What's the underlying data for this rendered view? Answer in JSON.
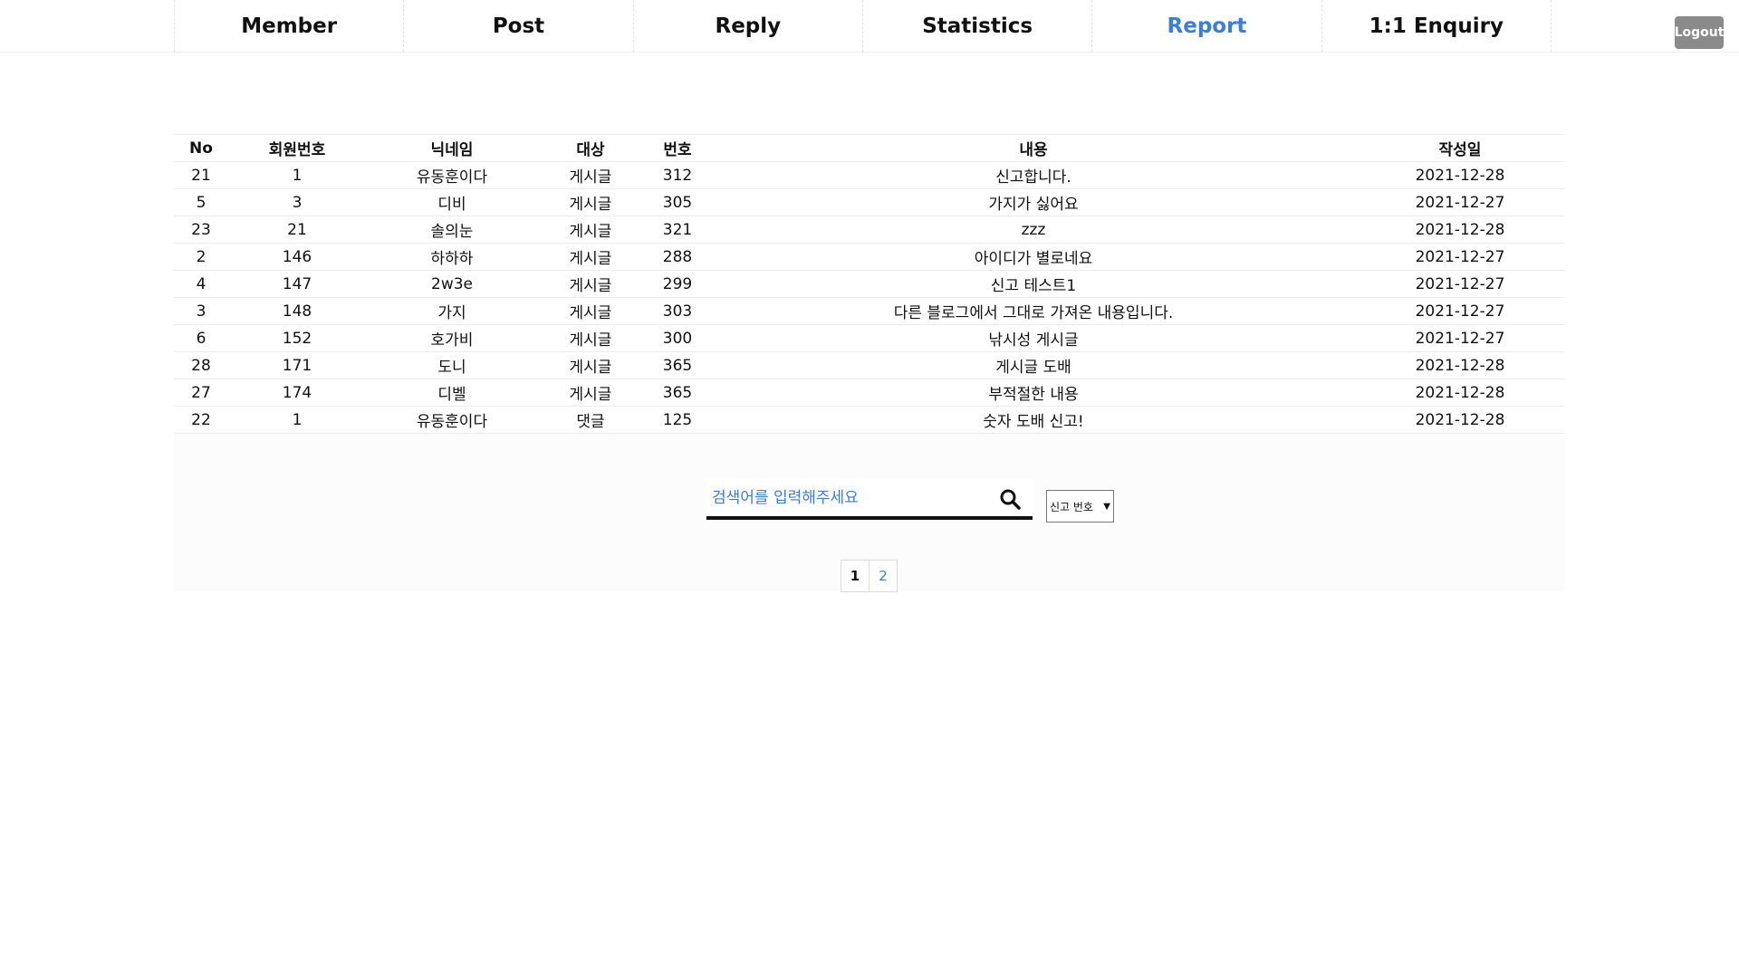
{
  "nav": {
    "items": [
      {
        "label": "Member",
        "active": false
      },
      {
        "label": "Post",
        "active": false
      },
      {
        "label": "Reply",
        "active": false
      },
      {
        "label": "Statistics",
        "active": false
      },
      {
        "label": "Report",
        "active": true
      },
      {
        "label": "1:1 Enquiry",
        "active": false
      }
    ],
    "logout_label": "Logout"
  },
  "table": {
    "headers": [
      "No",
      "회원번호",
      "닉네임",
      "대상",
      "번호",
      "내용",
      "작성일"
    ],
    "rows": [
      [
        "21",
        "1",
        "유동훈이다",
        "게시글",
        "312",
        "신고합니다.",
        "2021-12-28"
      ],
      [
        "5",
        "3",
        "디비",
        "게시글",
        "305",
        "가지가 싫어요",
        "2021-12-27"
      ],
      [
        "23",
        "21",
        "솔의눈",
        "게시글",
        "321",
        "zzz",
        "2021-12-28"
      ],
      [
        "2",
        "146",
        "하하하",
        "게시글",
        "288",
        "아이디가 별로네요",
        "2021-12-27"
      ],
      [
        "4",
        "147",
        "2w3e",
        "게시글",
        "299",
        "신고 테스트1",
        "2021-12-27"
      ],
      [
        "3",
        "148",
        "가지",
        "게시글",
        "303",
        "다른 블로그에서 그대로 가져온 내용입니다.",
        "2021-12-27"
      ],
      [
        "6",
        "152",
        "호가비",
        "게시글",
        "300",
        "낚시성 게시글",
        "2021-12-27"
      ],
      [
        "28",
        "171",
        "도니",
        "게시글",
        "365",
        "게시글 도배",
        "2021-12-28"
      ],
      [
        "27",
        "174",
        "디벨",
        "게시글",
        "365",
        "부적절한 내용",
        "2021-12-28"
      ],
      [
        "22",
        "1",
        "유동훈이다",
        "댓글",
        "125",
        "숫자 도배 신고!",
        "2021-12-28"
      ]
    ]
  },
  "search": {
    "placeholder": "검색어를 입력해주세요",
    "value": "",
    "icon": "search-icon",
    "select_value": "신고 번호"
  },
  "pagination": {
    "pages": [
      "1",
      "2"
    ],
    "current": "1"
  },
  "colors": {
    "accent": "#3b7ddd",
    "logout_bg": "#8a8a8a"
  }
}
